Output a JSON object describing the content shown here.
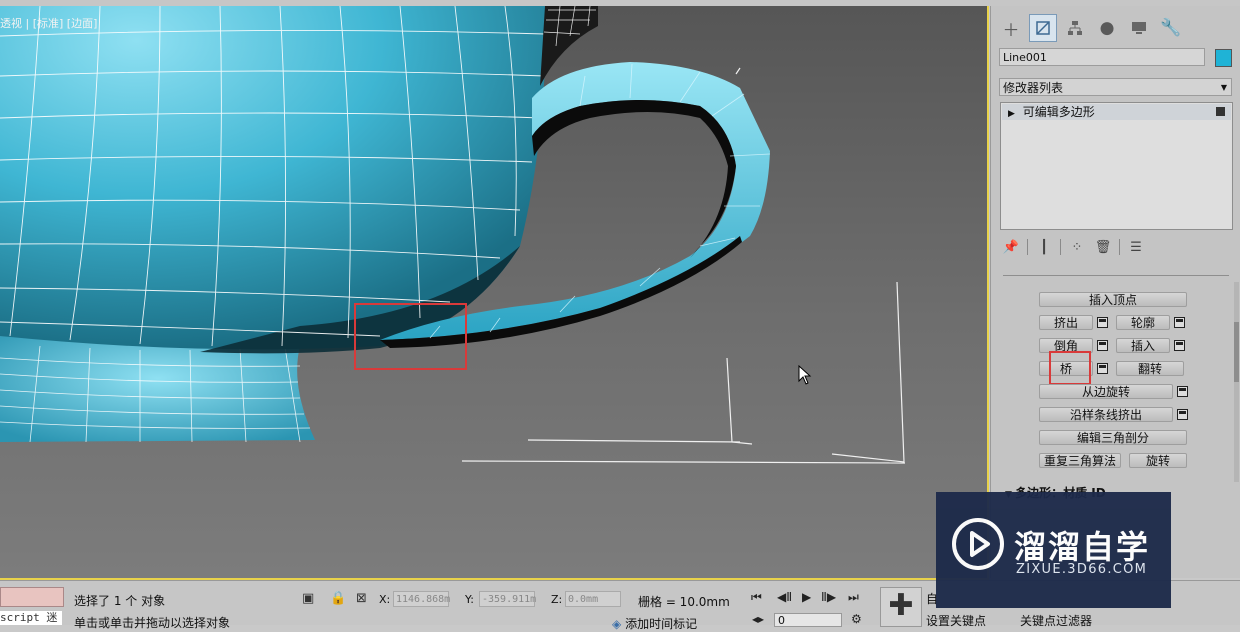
{
  "viewport": {
    "label": "透视 | [标准] [边面]"
  },
  "panel": {
    "tabs": [
      "create-icon",
      "modify-icon",
      "hierarchy-icon",
      "motion-icon",
      "display-icon",
      "utilities-icon"
    ],
    "object_name": "Line001",
    "object_color": "#1fb3d6",
    "modifier_list": "修改器列表",
    "stack_item": "可编辑多边形",
    "buttons": {
      "insert_vertex": "插入顶点",
      "extrude": "挤出",
      "outline": "轮廓",
      "bevel": "倒角",
      "inset": "插入",
      "bridge": "桥",
      "flip": "翻转",
      "hinge_from_edge": "从边旋转",
      "extrude_along_spline": "沿样条线挤出",
      "edit_triangulation": "编辑三角剖分",
      "retriangulate": "重复三角算法",
      "turn": "旋转"
    },
    "next_rollout": "多边形：材质 ID"
  },
  "status": {
    "selection": "选择了 1 个 对象",
    "hint": "单击或单击并拖动以选择对象",
    "script_label": "script 迷",
    "x_label": "X:",
    "x_value": "1146.868m",
    "y_label": "Y:",
    "y_value": "-359.911m",
    "z_label": "Z:",
    "z_value": "0.0mm",
    "grid": "栅格 = 10.0mm",
    "add_time_tag": "添加时间标记",
    "frame": "0",
    "auto_key": "自",
    "set_key": "设置关键点",
    "key_filters": "关键点过滤器"
  },
  "watermark": {
    "title": "溜溜自学",
    "subtitle": "ZIXUE.3D66.COM"
  },
  "colors": {
    "accent_highlight": "#d93a3a",
    "viewport_border": "#e8d24a",
    "mesh": "#3fb6d3"
  }
}
